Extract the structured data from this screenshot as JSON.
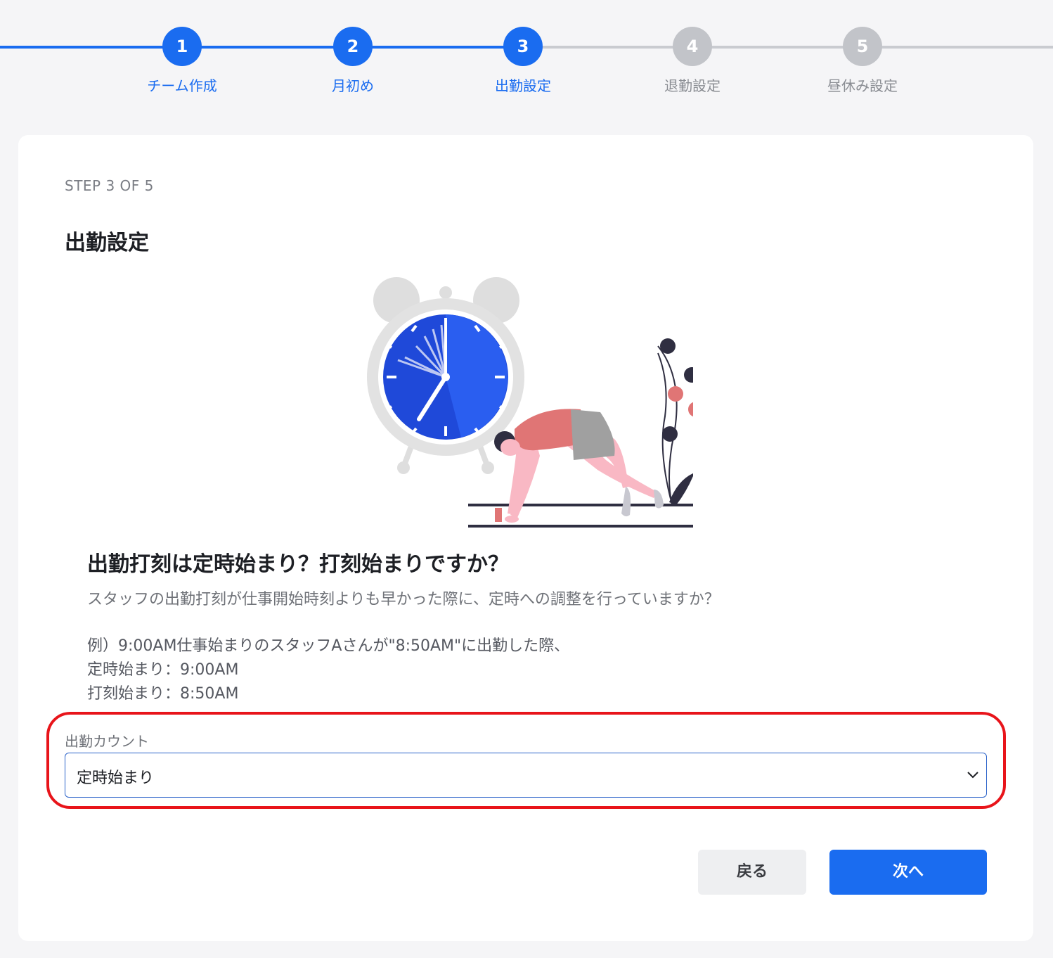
{
  "stepper": {
    "steps": [
      {
        "number": "1",
        "label": "チーム作成",
        "state": "done"
      },
      {
        "number": "2",
        "label": "月初め",
        "state": "done"
      },
      {
        "number": "3",
        "label": "出勤設定",
        "state": "current"
      },
      {
        "number": "4",
        "label": "退勤設定",
        "state": "todo"
      },
      {
        "number": "5",
        "label": "昼休み設定",
        "state": "todo"
      }
    ]
  },
  "card": {
    "step_count": "STEP 3 OF 5",
    "title": "出勤設定",
    "question": "出勤打刻は定時始まり？打刻始まりですか？",
    "description": "スタッフの出勤打刻が仕事開始時刻よりも早かった際に、定時への調整を行っていますか？",
    "example_lines": [
      "例）9:00AM仕事始まりのスタッフAさんが\"8:50AM\"に出勤した際、",
      "定時始まり：9:00AM",
      "打刻始まり：8:50AM"
    ],
    "field_label": "出勤カウント",
    "select_value": "定時始まり",
    "back_button": "戻る",
    "next_button": "次へ"
  },
  "colors": {
    "primary": "#1a6cf0",
    "highlight": "#e8141a"
  },
  "icons": {
    "select": "chevron-down-icon",
    "illustration": "alarm-clock-runner-illustration"
  }
}
